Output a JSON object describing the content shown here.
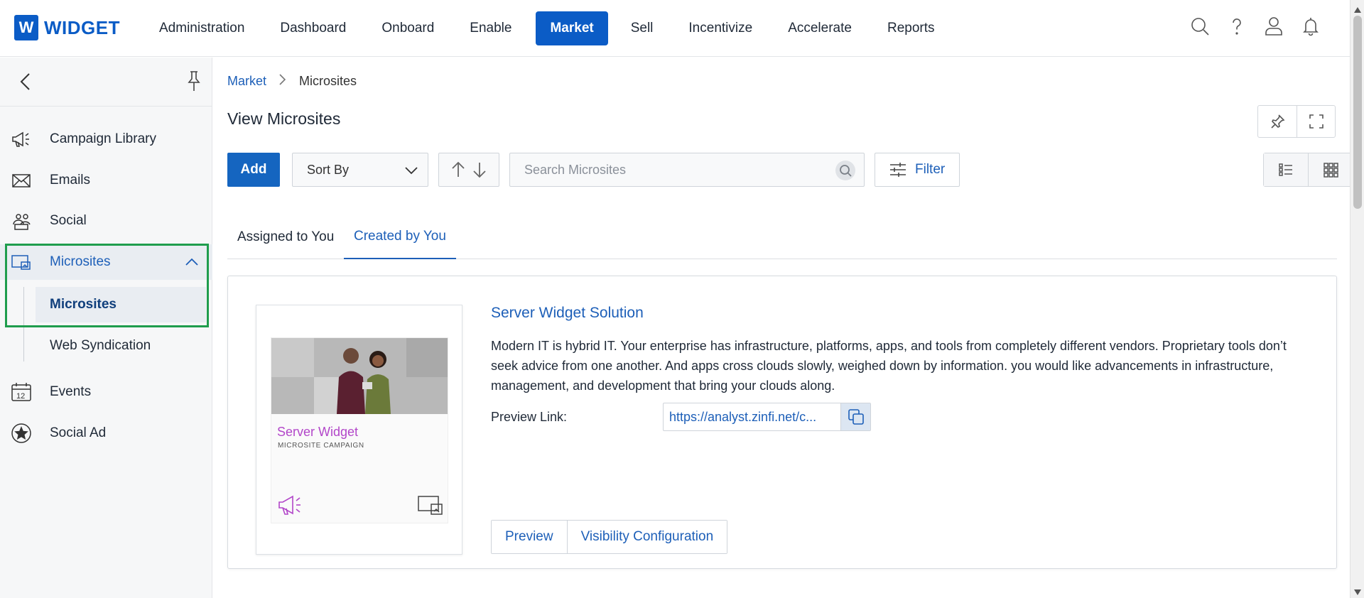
{
  "app": {
    "logo_letter": "W",
    "logo_text": "WIDGET"
  },
  "nav": {
    "items": [
      {
        "label": "Administration"
      },
      {
        "label": "Dashboard"
      },
      {
        "label": "Onboard"
      },
      {
        "label": "Enable"
      },
      {
        "label": "Market",
        "active": true
      },
      {
        "label": "Sell"
      },
      {
        "label": "Incentivize"
      },
      {
        "label": "Accelerate"
      },
      {
        "label": "Reports"
      }
    ],
    "icons": [
      "search-icon",
      "help-icon",
      "user-icon",
      "bell-icon"
    ]
  },
  "sidebar": {
    "items": [
      {
        "label": "Campaign Library",
        "icon": "megaphone-icon"
      },
      {
        "label": "Emails",
        "icon": "envelope-icon"
      },
      {
        "label": "Social",
        "icon": "social-icon"
      },
      {
        "label": "Microsites",
        "icon": "microsite-icon",
        "expanded": true
      },
      {
        "label": "Events",
        "icon": "calendar-icon",
        "calendar_day": "12"
      },
      {
        "label": "Social Ad",
        "icon": "star-badge-icon"
      }
    ],
    "subitems": [
      {
        "label": "Microsites",
        "active": true
      },
      {
        "label": "Web Syndication"
      }
    ]
  },
  "breadcrumb": {
    "parent": "Market",
    "current": "Microsites"
  },
  "page": {
    "title": "View Microsites"
  },
  "toolbar": {
    "add_label": "Add",
    "sort_label": "Sort By",
    "search_placeholder": "Search Microsites",
    "filter_label": "Filter"
  },
  "tabs": [
    {
      "label": "Assigned to You"
    },
    {
      "label": "Created by You",
      "active": true
    }
  ],
  "microsite": {
    "title": "Server Widget Solution",
    "description": "Modern IT is hybrid IT. Your enterprise has infrastructure, platforms, apps, and tools from completely different vendors. Proprietary tools don’t seek advice from one another. And apps cross clouds slowly, weighed down by information. you would like advancements in infrastructure, management, and development that bring your clouds along.",
    "preview_label": "Preview Link:",
    "preview_link": "https://analyst.zinfi.net/c...",
    "thumbnail_title": "Server Widget",
    "thumbnail_subtitle": "MICROSITE CAMPAIGN",
    "actions": {
      "preview": "Preview",
      "visibility": "Visibility Configuration"
    }
  },
  "colors": {
    "brand": "#0b5cc6",
    "link": "#1d5fb8",
    "highlight": "#1f9d4d",
    "thumbnail_accent": "#b246c9"
  }
}
